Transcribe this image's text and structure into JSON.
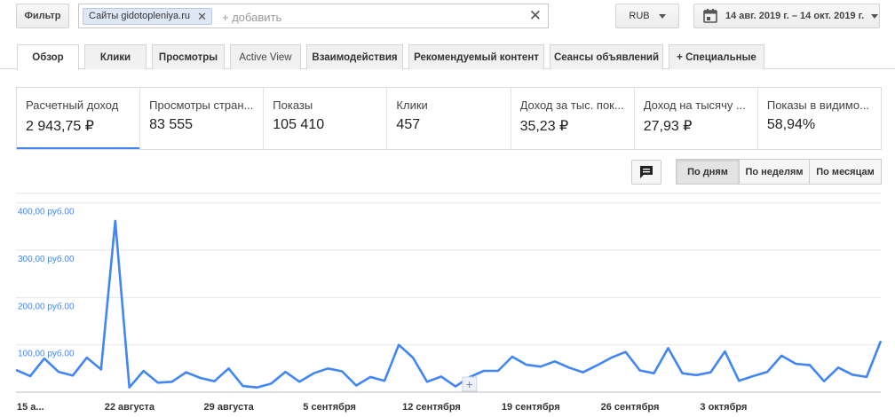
{
  "toolbar": {
    "filter_label": "Фильтр",
    "chip_label": "Сайты gidotopleniya.ru",
    "add_placeholder": "+ добавить",
    "currency": "RUB",
    "date_range": "14 авг. 2019 г. – 14 окт. 2019 г."
  },
  "tabs": [
    {
      "label": "Обзор"
    },
    {
      "label": "Клики"
    },
    {
      "label": "Просмотры"
    },
    {
      "label": "Active View"
    },
    {
      "label": "Взаимодействия"
    },
    {
      "label": "Рекомендуемый контент"
    },
    {
      "label": "Сеансы объявлений"
    },
    {
      "label": "+  Специальные"
    }
  ],
  "metrics": [
    {
      "label": "Расчетный доход",
      "value": "2 943,75 ₽"
    },
    {
      "label": "Просмотры стран...",
      "value": "83 555"
    },
    {
      "label": "Показы",
      "value": "105 410"
    },
    {
      "label": "Клики",
      "value": "457"
    },
    {
      "label": "Доход за тыс. пок...",
      "value": "35,23 ₽"
    },
    {
      "label": "Доход на тысячу ...",
      "value": "27,93 ₽"
    },
    {
      "label": "Показы в видимо...",
      "value": "58,94%"
    }
  ],
  "view_toggle": {
    "days": "По дням",
    "weeks": "По неделям",
    "months": "По месяцам",
    "selected": "days"
  },
  "colors": {
    "series": "#4285f4",
    "active_metric": "#4285f4"
  },
  "chart_data": {
    "type": "line",
    "series_name": "",
    "ylabel": "",
    "xlabel": "",
    "ylim": [
      0,
      420
    ],
    "y_ticks": [
      "400,00 руб.00",
      "300,00 руб.00",
      "200,00 руб.00",
      "100,00 руб.00"
    ],
    "y_tick_values": [
      400,
      300,
      200,
      100
    ],
    "x_tick_labels": [
      "15 а...",
      "22 августа",
      "29 августа",
      "5 сентября",
      "12 сентября",
      "19 сентября",
      "26 сентября",
      "3 октября"
    ],
    "x_tick_indices": [
      0,
      7,
      14,
      21,
      28,
      35,
      42,
      49
    ],
    "values": [
      47,
      34,
      71,
      43,
      35,
      73,
      48,
      362,
      10,
      45,
      20,
      22,
      42,
      30,
      23,
      50,
      13,
      10,
      18,
      43,
      22,
      40,
      50,
      44,
      14,
      32,
      24,
      100,
      73,
      22,
      33,
      12,
      32,
      45,
      45,
      75,
      58,
      54,
      65,
      52,
      42,
      57,
      73,
      85,
      46,
      40,
      93,
      40,
      36,
      42,
      86,
      24,
      34,
      43,
      77,
      60,
      57,
      23,
      52,
      37,
      32,
      108
    ]
  }
}
